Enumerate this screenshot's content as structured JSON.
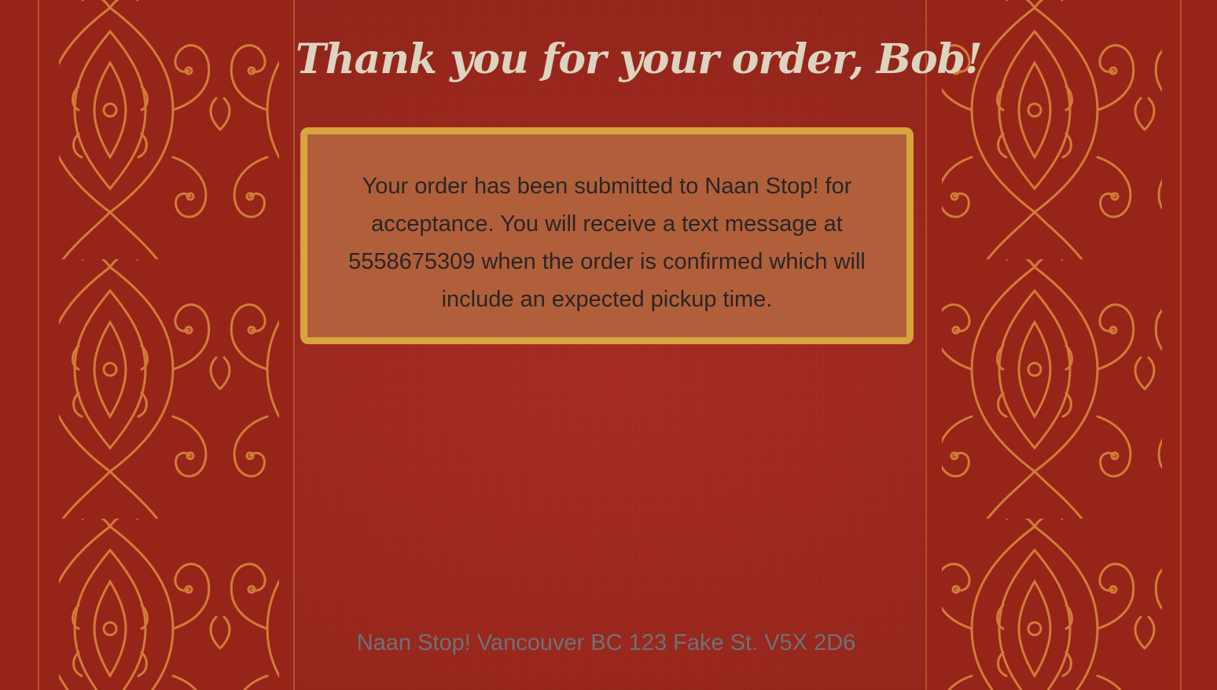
{
  "page": {
    "title": "Thank you for your order, Bob!",
    "confirmation_message": "Your order has been submitted to Naan Stop! for acceptance. You will receive a text message at 5558675309 when the order is confirmed which will include an expected pickup time.",
    "footer": "Naan Stop! Vancouver BC 123 Fake St. V5X 2D6"
  },
  "colors": {
    "background": "#9c2720",
    "ornament": "#d9853a",
    "message_box_fill": "#b15f3b",
    "message_box_border": "#d8a43e",
    "title_text": "#ddd3c1",
    "footer_text": "#6d7276"
  },
  "decorations": {
    "side_panels": "ornate-damask-pattern"
  }
}
